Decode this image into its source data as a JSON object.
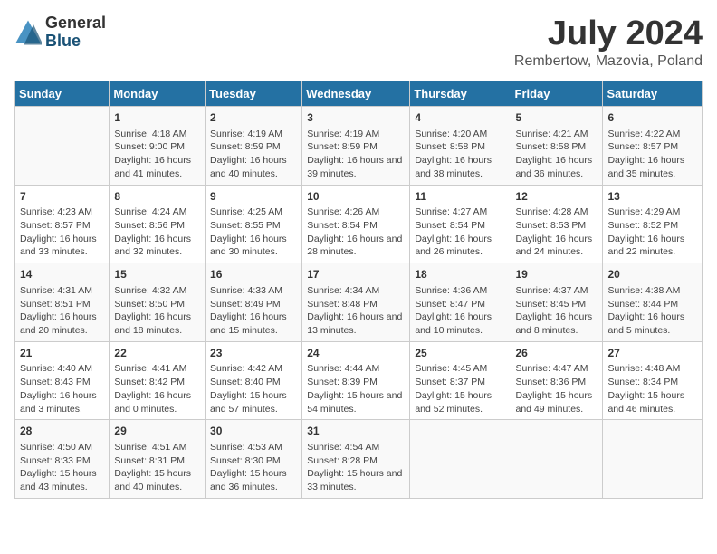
{
  "logo": {
    "general": "General",
    "blue": "Blue"
  },
  "title": "July 2024",
  "subtitle": "Rembertow, Mazovia, Poland",
  "headers": [
    "Sunday",
    "Monday",
    "Tuesday",
    "Wednesday",
    "Thursday",
    "Friday",
    "Saturday"
  ],
  "weeks": [
    [
      {
        "day": "",
        "info": ""
      },
      {
        "day": "1",
        "info": "Sunrise: 4:18 AM\nSunset: 9:00 PM\nDaylight: 16 hours and 41 minutes."
      },
      {
        "day": "2",
        "info": "Sunrise: 4:19 AM\nSunset: 8:59 PM\nDaylight: 16 hours and 40 minutes."
      },
      {
        "day": "3",
        "info": "Sunrise: 4:19 AM\nSunset: 8:59 PM\nDaylight: 16 hours and 39 minutes."
      },
      {
        "day": "4",
        "info": "Sunrise: 4:20 AM\nSunset: 8:58 PM\nDaylight: 16 hours and 38 minutes."
      },
      {
        "day": "5",
        "info": "Sunrise: 4:21 AM\nSunset: 8:58 PM\nDaylight: 16 hours and 36 minutes."
      },
      {
        "day": "6",
        "info": "Sunrise: 4:22 AM\nSunset: 8:57 PM\nDaylight: 16 hours and 35 minutes."
      }
    ],
    [
      {
        "day": "7",
        "info": "Sunrise: 4:23 AM\nSunset: 8:57 PM\nDaylight: 16 hours and 33 minutes."
      },
      {
        "day": "8",
        "info": "Sunrise: 4:24 AM\nSunset: 8:56 PM\nDaylight: 16 hours and 32 minutes."
      },
      {
        "day": "9",
        "info": "Sunrise: 4:25 AM\nSunset: 8:55 PM\nDaylight: 16 hours and 30 minutes."
      },
      {
        "day": "10",
        "info": "Sunrise: 4:26 AM\nSunset: 8:54 PM\nDaylight: 16 hours and 28 minutes."
      },
      {
        "day": "11",
        "info": "Sunrise: 4:27 AM\nSunset: 8:54 PM\nDaylight: 16 hours and 26 minutes."
      },
      {
        "day": "12",
        "info": "Sunrise: 4:28 AM\nSunset: 8:53 PM\nDaylight: 16 hours and 24 minutes."
      },
      {
        "day": "13",
        "info": "Sunrise: 4:29 AM\nSunset: 8:52 PM\nDaylight: 16 hours and 22 minutes."
      }
    ],
    [
      {
        "day": "14",
        "info": "Sunrise: 4:31 AM\nSunset: 8:51 PM\nDaylight: 16 hours and 20 minutes."
      },
      {
        "day": "15",
        "info": "Sunrise: 4:32 AM\nSunset: 8:50 PM\nDaylight: 16 hours and 18 minutes."
      },
      {
        "day": "16",
        "info": "Sunrise: 4:33 AM\nSunset: 8:49 PM\nDaylight: 16 hours and 15 minutes."
      },
      {
        "day": "17",
        "info": "Sunrise: 4:34 AM\nSunset: 8:48 PM\nDaylight: 16 hours and 13 minutes."
      },
      {
        "day": "18",
        "info": "Sunrise: 4:36 AM\nSunset: 8:47 PM\nDaylight: 16 hours and 10 minutes."
      },
      {
        "day": "19",
        "info": "Sunrise: 4:37 AM\nSunset: 8:45 PM\nDaylight: 16 hours and 8 minutes."
      },
      {
        "day": "20",
        "info": "Sunrise: 4:38 AM\nSunset: 8:44 PM\nDaylight: 16 hours and 5 minutes."
      }
    ],
    [
      {
        "day": "21",
        "info": "Sunrise: 4:40 AM\nSunset: 8:43 PM\nDaylight: 16 hours and 3 minutes."
      },
      {
        "day": "22",
        "info": "Sunrise: 4:41 AM\nSunset: 8:42 PM\nDaylight: 16 hours and 0 minutes."
      },
      {
        "day": "23",
        "info": "Sunrise: 4:42 AM\nSunset: 8:40 PM\nDaylight: 15 hours and 57 minutes."
      },
      {
        "day": "24",
        "info": "Sunrise: 4:44 AM\nSunset: 8:39 PM\nDaylight: 15 hours and 54 minutes."
      },
      {
        "day": "25",
        "info": "Sunrise: 4:45 AM\nSunset: 8:37 PM\nDaylight: 15 hours and 52 minutes."
      },
      {
        "day": "26",
        "info": "Sunrise: 4:47 AM\nSunset: 8:36 PM\nDaylight: 15 hours and 49 minutes."
      },
      {
        "day": "27",
        "info": "Sunrise: 4:48 AM\nSunset: 8:34 PM\nDaylight: 15 hours and 46 minutes."
      }
    ],
    [
      {
        "day": "28",
        "info": "Sunrise: 4:50 AM\nSunset: 8:33 PM\nDaylight: 15 hours and 43 minutes."
      },
      {
        "day": "29",
        "info": "Sunrise: 4:51 AM\nSunset: 8:31 PM\nDaylight: 15 hours and 40 minutes."
      },
      {
        "day": "30",
        "info": "Sunrise: 4:53 AM\nSunset: 8:30 PM\nDaylight: 15 hours and 36 minutes."
      },
      {
        "day": "31",
        "info": "Sunrise: 4:54 AM\nSunset: 8:28 PM\nDaylight: 15 hours and 33 minutes."
      },
      {
        "day": "",
        "info": ""
      },
      {
        "day": "",
        "info": ""
      },
      {
        "day": "",
        "info": ""
      }
    ]
  ]
}
